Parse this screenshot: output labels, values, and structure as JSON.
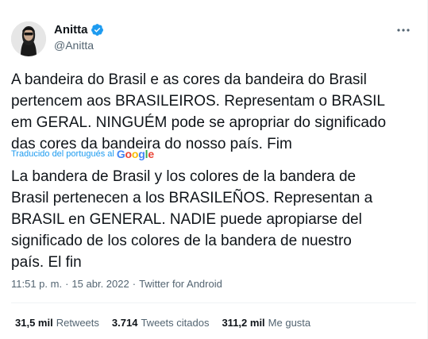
{
  "author": {
    "name": "Anitta",
    "handle": "@Anitta"
  },
  "more_icon": "more-dots-icon",
  "tweet": {
    "text_original": "A bandeira do Brasil e as cores da bandeira do Brasil\npertencem aos BRASILEIROS. Representam o BRASIL\nem GERAL. NINGUÉM pode se apropriar do significado\ndas cores da bandeira do nosso país. Fim",
    "translated_label": "Traducido del portugués al",
    "translation_provider": "Google",
    "text_translation": "La bandera de Brasil y los colores de la bandera de\nBrasil pertenecen a los BRASILEÑOS. Representan a\nBRASIL en GENERAL. NADIE puede apropiarse del\nsignificado de los colores de la bandera de nuestro\npaís. El fin",
    "time": "11:51 p. m.",
    "date": "15 abr. 2022",
    "source": "Twitter for Android",
    "separator": "·"
  },
  "stats": [
    {
      "count": "31,5 mil",
      "label": "Retweets"
    },
    {
      "count": "3.714",
      "label": "Tweets citados"
    },
    {
      "count": "311,2 mil",
      "label": "Me gusta"
    }
  ],
  "colors": {
    "accent": "#1d9bf0",
    "text": "#0f1419",
    "secondary": "#536471"
  }
}
